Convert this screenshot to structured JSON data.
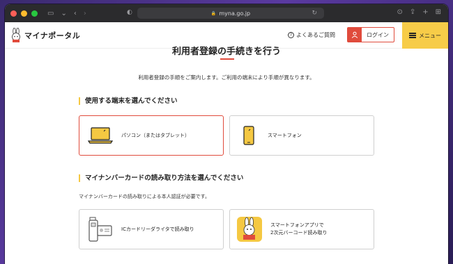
{
  "browser": {
    "url": "myna.go.jp",
    "lock_glyph": "🔒",
    "reload_glyph": "↻"
  },
  "header": {
    "logo_text": "マイナポータル",
    "faq_label": "よくあるご質問",
    "login_label": "ログイン",
    "menu_label": "メニュー"
  },
  "page": {
    "cut_title": "利用者登録の手続きを行う",
    "lead": "利用者登録の手順をご案内します。ご利用の端末により手順が異なります。"
  },
  "device_section": {
    "heading": "使用する端末を選んでください",
    "options": [
      {
        "label": "パソコン（またはタブレット）",
        "icon": "laptop-icon",
        "selected": true
      },
      {
        "label": "スマートフォン",
        "icon": "smartphone-icon",
        "selected": false
      }
    ]
  },
  "card_section": {
    "heading": "マイナンバーカードの読み取り方法を選んでください",
    "subtext": "マイナンバーカードの読み取りによる本人認証が必要です。",
    "options": [
      {
        "label": "ICカードリーダライタで読み取り",
        "icon": "card-reader-icon"
      },
      {
        "label": "スマートフォンアプリで\n2次元バーコード読み取り",
        "icon": "mynaportal-app-icon"
      }
    ]
  },
  "colors": {
    "accent_red": "#e04b3c",
    "accent_yellow": "#f7cc48",
    "heading_bar": "#f5c842"
  }
}
